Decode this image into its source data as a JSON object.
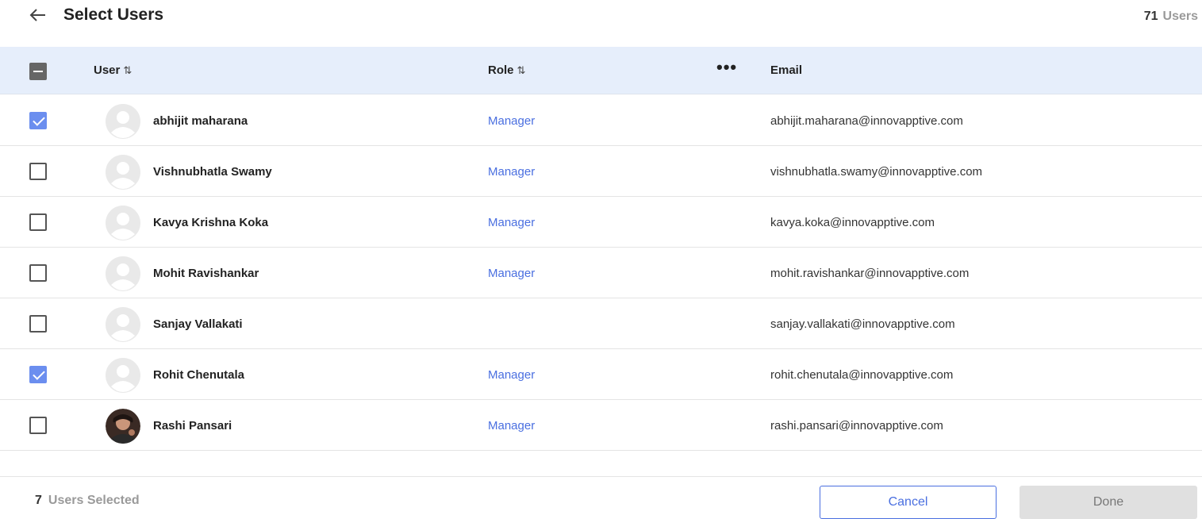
{
  "header": {
    "title": "Select Users",
    "count_number": "71",
    "count_label": "Users"
  },
  "table": {
    "columns": {
      "user": "User",
      "role": "Role",
      "email": "Email",
      "sort_glyph": "⇅",
      "more": "•••"
    },
    "header_checkbox_state": "indeterminate",
    "rows": [
      {
        "name": "abhijit maharana",
        "role": "Manager",
        "email": "abhijit.maharana@innovapptive.com",
        "checked": true,
        "avatar": "placeholder"
      },
      {
        "name": "Vishnubhatla Swamy",
        "role": "Manager",
        "email": "vishnubhatla.swamy@innovapptive.com",
        "checked": false,
        "avatar": "placeholder"
      },
      {
        "name": "Kavya Krishna Koka",
        "role": "Manager",
        "email": "kavya.koka@innovapptive.com",
        "checked": false,
        "avatar": "placeholder"
      },
      {
        "name": "Mohit Ravishankar",
        "role": "Manager",
        "email": "mohit.ravishankar@innovapptive.com",
        "checked": false,
        "avatar": "placeholder"
      },
      {
        "name": "Sanjay Vallakati",
        "role": "",
        "email": "sanjay.vallakati@innovapptive.com",
        "checked": false,
        "avatar": "placeholder"
      },
      {
        "name": "Rohit Chenutala",
        "role": "Manager",
        "email": "rohit.chenutala@innovapptive.com",
        "checked": true,
        "avatar": "placeholder"
      },
      {
        "name": "Rashi Pansari",
        "role": "Manager",
        "email": "rashi.pansari@innovapptive.com",
        "checked": false,
        "avatar": "photo"
      }
    ]
  },
  "footer": {
    "selected_number": "7",
    "selected_label": "Users Selected",
    "cancel_label": "Cancel",
    "done_label": "Done"
  },
  "colors": {
    "accent": "#4a6fe0",
    "checkbox_checked": "#6b8eef",
    "header_bg": "#e6eefb",
    "done_bg": "#e0e0e0"
  },
  "icons": {
    "back": "arrow-left-icon",
    "avatar_placeholder": "user-placeholder-icon",
    "more": "more-horizontal-icon"
  }
}
